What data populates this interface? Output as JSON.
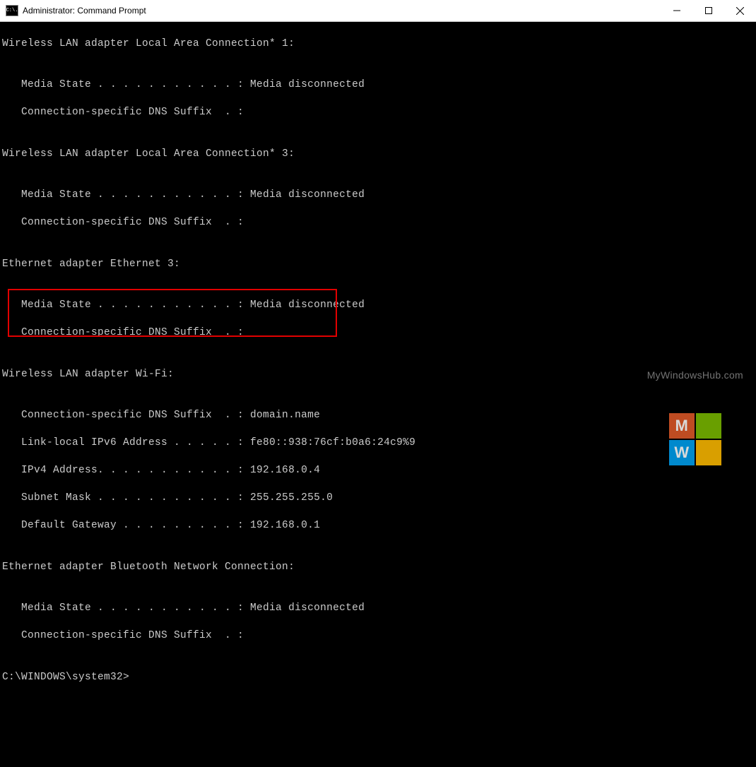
{
  "window": {
    "title": "Administrator: Command Prompt",
    "icon_text": "C:\\."
  },
  "lines": {
    "l0": "Wireless LAN adapter Local Area Connection* 1:",
    "l1": "",
    "l2": "   Media State . . . . . . . . . . . : Media disconnected",
    "l3": "   Connection-specific DNS Suffix  . :",
    "l4": "",
    "l5": "Wireless LAN adapter Local Area Connection* 3:",
    "l6": "",
    "l7": "   Media State . . . . . . . . . . . : Media disconnected",
    "l8": "   Connection-specific DNS Suffix  . :",
    "l9": "",
    "l10": "Ethernet adapter Ethernet 3:",
    "l11": "",
    "l12": "   Media State . . . . . . . . . . . : Media disconnected",
    "l13": "   Connection-specific DNS Suffix  . :",
    "l14": "",
    "l15": "Wireless LAN adapter Wi-Fi:",
    "l16": "",
    "l17": "   Connection-specific DNS Suffix  . : domain.name",
    "l18": "   Link-local IPv6 Address . . . . . : fe80::938:76cf:b0a6:24c9%9",
    "l19": "   IPv4 Address. . . . . . . . . . . : 192.168.0.4",
    "l20": "   Subnet Mask . . . . . . . . . . . : 255.255.255.0",
    "l21": "   Default Gateway . . . . . . . . . : 192.168.0.1",
    "l22": "",
    "l23": "Ethernet adapter Bluetooth Network Connection:",
    "l24": "",
    "l25": "   Media State . . . . . . . . . . . : Media disconnected",
    "l26": "   Connection-specific DNS Suffix  . :",
    "l27": "",
    "l28": "C:\\WINDOWS\\system32>"
  },
  "watermark": {
    "text": "MyWindowsHub.com",
    "letters": {
      "a": "M",
      "b": "",
      "c": "W",
      "d": ""
    }
  }
}
